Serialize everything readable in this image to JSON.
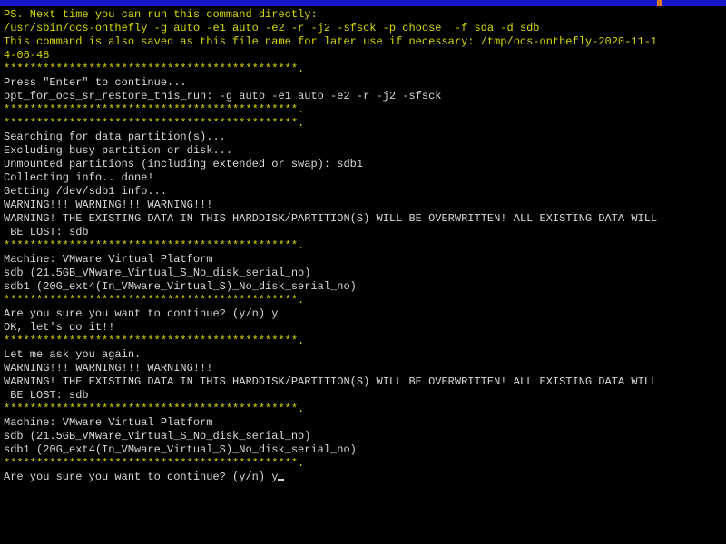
{
  "lines": [
    {
      "cls": "yellow",
      "text": "PS. Next time you can run this command directly:"
    },
    {
      "cls": "yellow",
      "text": "/usr/sbin/ocs-onthefly -g auto -e1 auto -e2 -r -j2 -sfsck -p choose  -f sda -d sdb"
    },
    {
      "cls": "yellow",
      "text": "This command is also saved as this file name for later use if necessary: /tmp/ocs-onthefly-2020-11-1"
    },
    {
      "cls": "yellow",
      "text": "4-06-48"
    },
    {
      "cls": "yellow",
      "text": "*********************************************."
    },
    {
      "cls": "white",
      "text": "Press \"Enter\" to continue..."
    },
    {
      "cls": "white",
      "text": "opt_for_ocs_sr_restore_this_run: -g auto -e1 auto -e2 -r -j2 -sfsck"
    },
    {
      "cls": "yellow",
      "text": "*********************************************."
    },
    {
      "cls": "yellow",
      "text": "*********************************************."
    },
    {
      "cls": "white",
      "text": "Searching for data partition(s)..."
    },
    {
      "cls": "white",
      "text": "Excluding busy partition or disk..."
    },
    {
      "cls": "white",
      "text": "Unmounted partitions (including extended or swap): sdb1"
    },
    {
      "cls": "white",
      "text": "Collecting info.. done!"
    },
    {
      "cls": "white",
      "text": "Getting /dev/sdb1 info..."
    },
    {
      "cls": "white",
      "text": "WARNING!!! WARNING!!! WARNING!!!"
    },
    {
      "cls": "white",
      "text": "WARNING! THE EXISTING DATA IN THIS HARDDISK/PARTITION(S) WILL BE OVERWRITTEN! ALL EXISTING DATA WILL"
    },
    {
      "cls": "white",
      "text": " BE LOST: sdb"
    },
    {
      "cls": "yellow",
      "text": "*********************************************."
    },
    {
      "cls": "white",
      "text": "Machine: VMware Virtual Platform"
    },
    {
      "cls": "white",
      "text": "sdb (21.5GB_VMware_Virtual_S_No_disk_serial_no)"
    },
    {
      "cls": "white",
      "text": "sdb1 (20G_ext4(In_VMware_Virtual_S)_No_disk_serial_no)"
    },
    {
      "cls": "yellow",
      "text": "*********************************************."
    },
    {
      "cls": "white",
      "text": "Are you sure you want to continue? (y/n) y"
    },
    {
      "cls": "white",
      "text": "OK, let's do it!!"
    },
    {
      "cls": "yellow",
      "text": "*********************************************."
    },
    {
      "cls": "white",
      "text": "Let me ask you again."
    },
    {
      "cls": "white",
      "text": "WARNING!!! WARNING!!! WARNING!!!"
    },
    {
      "cls": "white",
      "text": "WARNING! THE EXISTING DATA IN THIS HARDDISK/PARTITION(S) WILL BE OVERWRITTEN! ALL EXISTING DATA WILL"
    },
    {
      "cls": "white",
      "text": " BE LOST: sdb"
    },
    {
      "cls": "yellow",
      "text": "*********************************************."
    },
    {
      "cls": "white",
      "text": "Machine: VMware Virtual Platform"
    },
    {
      "cls": "white",
      "text": "sdb (21.5GB_VMware_Virtual_S_No_disk_serial_no)"
    },
    {
      "cls": "white",
      "text": "sdb1 (20G_ext4(In_VMware_Virtual_S)_No_disk_serial_no)"
    },
    {
      "cls": "yellow",
      "text": "*********************************************."
    }
  ],
  "prompt": {
    "text": "Are you sure you want to continue? (y/n) ",
    "input": "y"
  }
}
